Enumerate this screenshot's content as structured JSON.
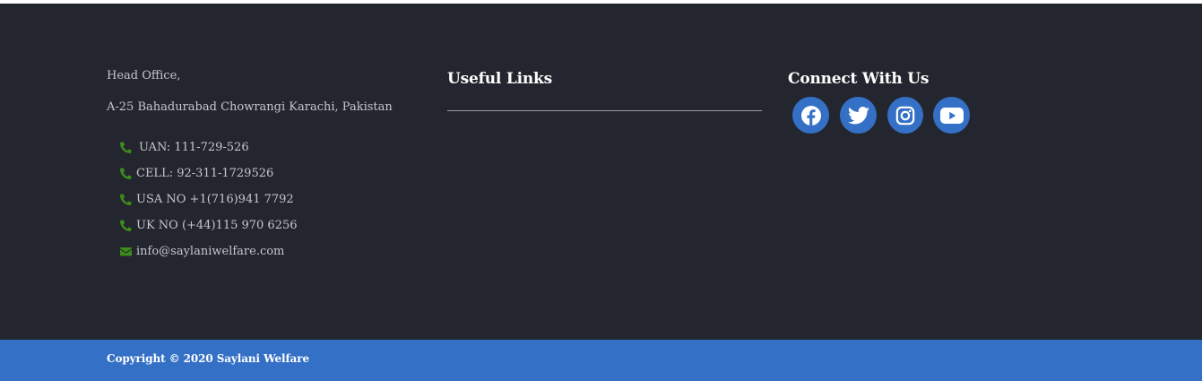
{
  "office": {
    "title": "Head Office,",
    "address": "A-25 Bahadurabad Chowrangi Karachi, Pakistan",
    "contacts": [
      {
        "icon": "phone-icon",
        "text": "UAN: 111-729-526"
      },
      {
        "icon": "phone-icon",
        "text": "CELL: 92-311-1729526"
      },
      {
        "icon": "phone-icon",
        "text": "USA NO +1(716)941 7792"
      },
      {
        "icon": "phone-icon",
        "text": "UK NO (+44)115 970 6256"
      },
      {
        "icon": "envelope-icon",
        "text": "info@saylaniwelfare.com"
      }
    ]
  },
  "useful_links": {
    "title": "Useful Links"
  },
  "connect": {
    "title": "Connect With Us",
    "social": [
      {
        "icon": "facebook-icon",
        "name": "Facebook"
      },
      {
        "icon": "twitter-icon",
        "name": "Twitter"
      },
      {
        "icon": "instagram-icon",
        "name": "Instagram"
      },
      {
        "icon": "youtube-icon",
        "name": "YouTube"
      }
    ]
  },
  "footer": {
    "copyright": "Copyright © 2020 Saylani Welfare"
  },
  "colors": {
    "background": "#24262f",
    "accent": "#3470c6",
    "icon_green": "#3d8c1a",
    "text": "#c5c7cc"
  }
}
